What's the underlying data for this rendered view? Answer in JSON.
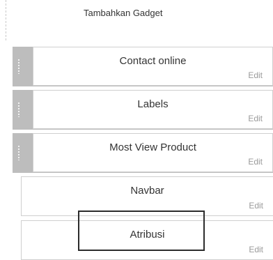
{
  "add_gadget": {
    "label": "Tambahkan Gadget"
  },
  "widgets": [
    {
      "title": "Contact online",
      "edit_label": "Edit",
      "draggable": true
    },
    {
      "title": "Labels",
      "edit_label": "Edit",
      "draggable": true
    },
    {
      "title": "Most View Product",
      "edit_label": "Edit",
      "draggable": true
    },
    {
      "title": "Navbar",
      "edit_label": "Edit",
      "draggable": false
    },
    {
      "title": "Atribusi",
      "edit_label": "Edit",
      "draggable": false
    }
  ]
}
